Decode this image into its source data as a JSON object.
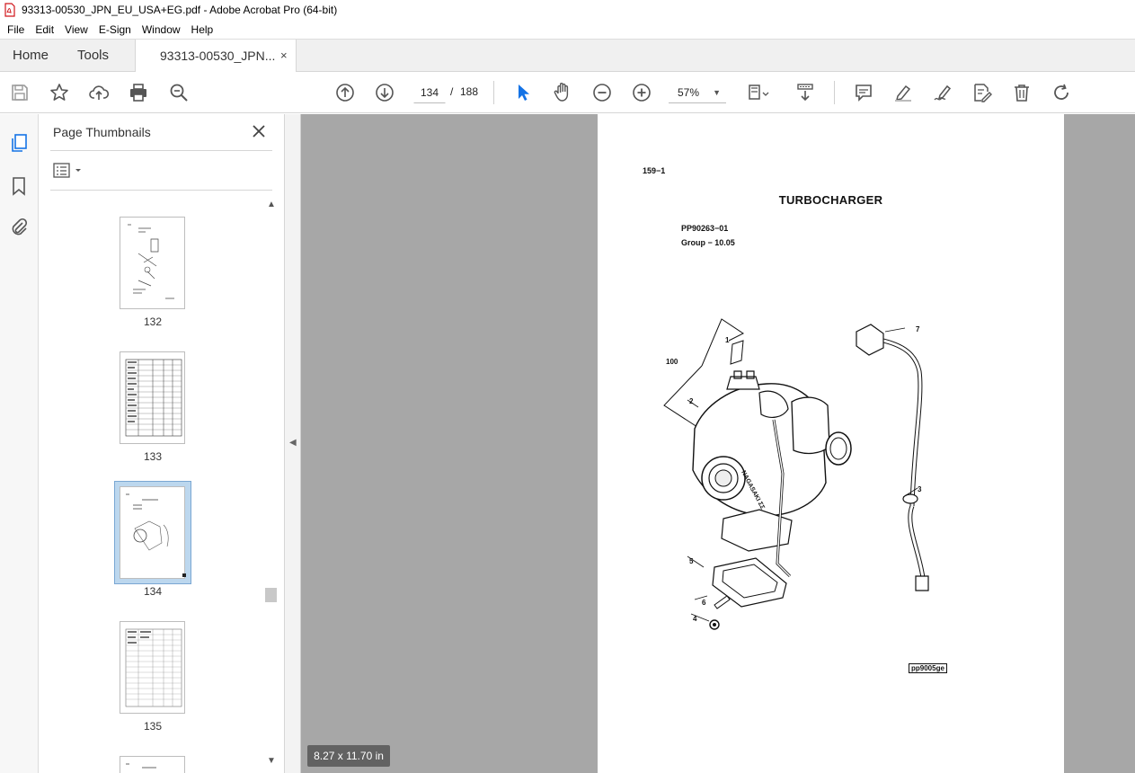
{
  "window": {
    "title": "93313-00530_JPN_EU_USA+EG.pdf - Adobe Acrobat Pro (64-bit)"
  },
  "menu": [
    "File",
    "Edit",
    "View",
    "E-Sign",
    "Window",
    "Help"
  ],
  "tabs": {
    "home": "Home",
    "tools": "Tools",
    "document": "93313-00530_JPN...",
    "close_glyph": "×"
  },
  "toolbar": {
    "left_icons": [
      "save-icon",
      "bookmark-star-icon",
      "upload-cloud-icon",
      "print-icon",
      "find-zoom-icon"
    ],
    "nav_icons": [
      "previous-page-icon",
      "next-page-icon"
    ],
    "current_page": "134",
    "page_separator": "/",
    "total_pages": "188",
    "tool_icons": [
      "select-cursor-icon",
      "hand-tool-icon",
      "zoom-out-icon",
      "zoom-in-icon"
    ],
    "zoom": "57%",
    "right_icons": [
      "fit-page-icon",
      "scroll-mode-icon",
      "comment-icon",
      "highlight-pen-icon",
      "sign-icon",
      "edit-pdf-icon",
      "delete-icon",
      "rotate-icon"
    ],
    "accent": "#1473e6"
  },
  "rail": {
    "icons": [
      "page-thumbnails-icon",
      "bookmarks-icon",
      "attachments-icon"
    ]
  },
  "thumbnails_panel": {
    "title": "Page Thumbnails",
    "pages": [
      {
        "label": "132",
        "selected": false
      },
      {
        "label": "133",
        "selected": false
      },
      {
        "label": "134",
        "selected": true
      },
      {
        "label": "135",
        "selected": false
      }
    ]
  },
  "document_page": {
    "page_ref": "159−1",
    "title": "TURBOCHARGER",
    "part_number": "PP90263−01",
    "group": "Group − 10.05",
    "callouts": [
      "100",
      "1",
      "2",
      "7",
      "3",
      "5",
      "6",
      "4"
    ],
    "figure_code": "pp9005ge"
  },
  "status": {
    "page_size": "8.27 x 11.70 in"
  }
}
